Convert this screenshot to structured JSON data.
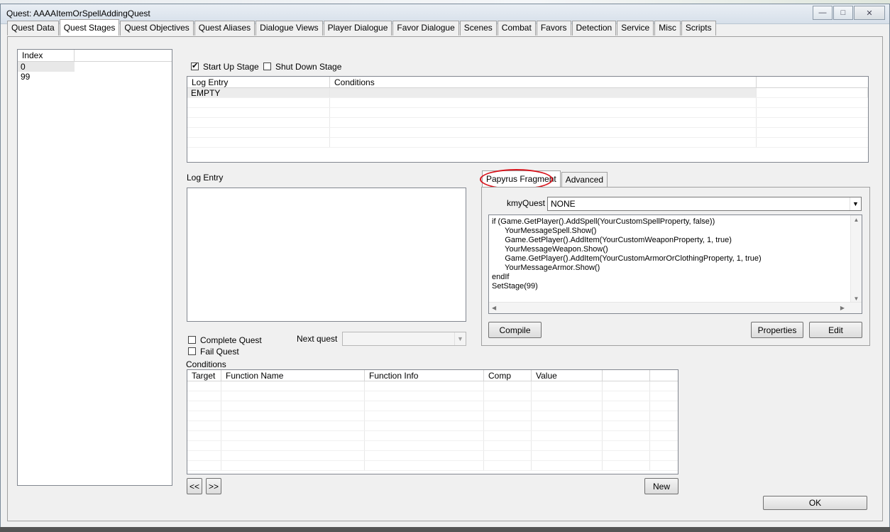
{
  "window": {
    "title": "Quest: AAAAItemOrSpellAddingQuest",
    "minimize": "—",
    "maximize": "□",
    "close": "✕"
  },
  "tabs": [
    {
      "label": "Quest Data"
    },
    {
      "label": "Quest Stages",
      "active": true
    },
    {
      "label": "Quest Objectives"
    },
    {
      "label": "Quest Aliases"
    },
    {
      "label": "Dialogue Views"
    },
    {
      "label": "Player Dialogue"
    },
    {
      "label": "Favor Dialogue"
    },
    {
      "label": "Scenes"
    },
    {
      "label": "Combat"
    },
    {
      "label": "Favors"
    },
    {
      "label": "Detection"
    },
    {
      "label": "Service"
    },
    {
      "label": "Misc"
    },
    {
      "label": "Scripts"
    }
  ],
  "index_list": {
    "header": "Index",
    "rows": [
      "0",
      "99"
    ]
  },
  "stage_options": {
    "start_up_label": "Start Up Stage",
    "start_up_checked": true,
    "shut_down_label": "Shut Down Stage",
    "shut_down_checked": false
  },
  "log_entries_grid": {
    "headers": [
      "Log Entry",
      "Conditions",
      ""
    ],
    "rows": [
      [
        "EMPTY",
        "",
        ""
      ]
    ]
  },
  "log_entry": {
    "label": "Log Entry",
    "text": ""
  },
  "quest_flags": {
    "complete_label": "Complete Quest",
    "fail_label": "Fail Quest",
    "next_quest_label": "Next quest",
    "next_quest_value": ""
  },
  "papyrus": {
    "tabs": [
      "Papyrus Fragment",
      "Advanced"
    ],
    "property_label": "kmyQuest",
    "property_value": "NONE",
    "code_lines": [
      "if (Game.GetPlayer().AddSpell(YourCustomSpellProperty, false))",
      "      YourMessageSpell.Show()",
      "      Game.GetPlayer().AddItem(YourCustomWeaponProperty, 1, true)",
      "      YourMessageWeapon.Show()",
      "      Game.GetPlayer().AddItem(YourCustomArmorOrClothingProperty, 1, true)",
      "      YourMessageArmor.Show()",
      "endIf",
      "SetStage(99)"
    ],
    "compile_label": "Compile",
    "properties_label": "Properties",
    "edit_label": "Edit"
  },
  "conditions": {
    "label": "Conditions",
    "headers": [
      "Target",
      "Function Name",
      "Function Info",
      "Comp",
      "Value",
      "",
      ""
    ],
    "prev_label": "<<",
    "next_label": ">>",
    "new_label": "New"
  },
  "ok_label": "OK",
  "icons": {
    "scroll_up": "▲",
    "scroll_down": "▼",
    "scroll_left": "◀",
    "scroll_right": "▶",
    "combo_arrow": "▼"
  },
  "colors": {
    "highlight_ellipse": "#d7141c"
  }
}
